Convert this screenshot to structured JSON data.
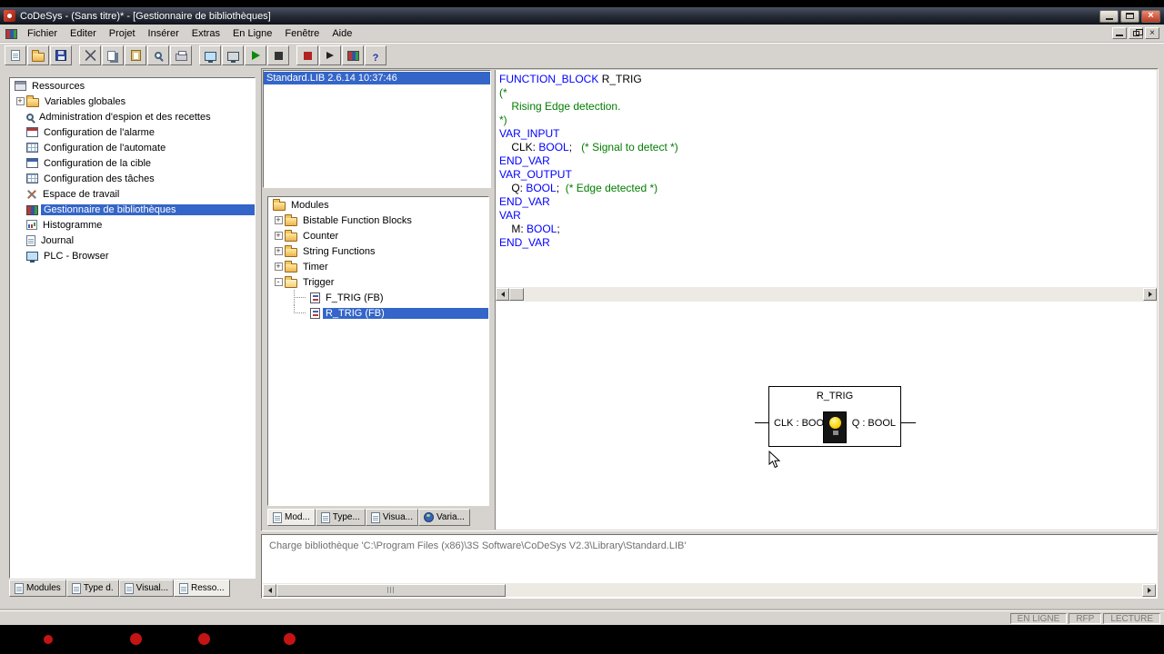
{
  "titlebar": {
    "title": "CoDeSys - (Sans titre)* - [Gestionnaire de bibliothèques]"
  },
  "menubar": {
    "items": [
      "Fichier",
      "Editer",
      "Projet",
      "Insérer",
      "Extras",
      "En Ligne",
      "Fenêtre",
      "Aide"
    ]
  },
  "toolbar": {
    "groups": [
      [
        "new-file",
        "open-file",
        "save"
      ],
      [
        "cut",
        "copy",
        "paste",
        "find",
        "print"
      ],
      [
        "login",
        "logout",
        "run",
        "stop"
      ],
      [
        "breakpoint",
        "step-over",
        "library-manager",
        "help"
      ]
    ]
  },
  "resources": {
    "root_label": "Ressources",
    "items": [
      {
        "label": "Variables globales",
        "icon": "folder",
        "expander": "+"
      },
      {
        "label": "Administration d'espion et des recettes",
        "icon": "magnifier"
      },
      {
        "label": "Configuration de l'alarme",
        "icon": "alarm-config"
      },
      {
        "label": "Configuration de l'automate",
        "icon": "plc-config"
      },
      {
        "label": "Configuration de la cible",
        "icon": "target-config"
      },
      {
        "label": "Configuration des tâches",
        "icon": "task-config"
      },
      {
        "label": "Espace de travail",
        "icon": "workspace"
      },
      {
        "label": "Gestionnaire de bibliothèques",
        "icon": "library",
        "selected": true
      },
      {
        "label": "Histogramme",
        "icon": "histogram"
      },
      {
        "label": "Journal",
        "icon": "journal"
      },
      {
        "label": "PLC - Browser",
        "icon": "plc-browser"
      }
    ],
    "tabs": [
      {
        "label": "Modules",
        "icon": "page"
      },
      {
        "label": "Type d.",
        "icon": "page"
      },
      {
        "label": "Visual...",
        "icon": "page"
      },
      {
        "label": "Resso...",
        "icon": "page",
        "active": true
      }
    ]
  },
  "library_list": {
    "rows": [
      {
        "label": "Standard.LIB 2.6.14 10:37:46",
        "selected": true
      }
    ]
  },
  "module_tree": {
    "root_label": "Modules",
    "items": [
      {
        "label": "Bistable Function Blocks",
        "icon": "folder",
        "expander": "+",
        "level": 1
      },
      {
        "label": "Counter",
        "icon": "folder",
        "expander": "+",
        "level": 1
      },
      {
        "label": "String Functions",
        "icon": "folder",
        "expander": "+",
        "level": 1
      },
      {
        "label": "Timer",
        "icon": "folder",
        "expander": "+",
        "level": 1
      },
      {
        "label": "Trigger",
        "icon": "folder-open",
        "expander": "-",
        "level": 1
      },
      {
        "label": "F_TRIG (FB)",
        "icon": "pou",
        "level": 2
      },
      {
        "label": "R_TRIG (FB)",
        "icon": "pou",
        "level": 2,
        "selected": true,
        "last": true
      }
    ],
    "tabs": [
      {
        "label": "Mod...",
        "icon": "page",
        "active": true
      },
      {
        "label": "Type...",
        "icon": "page"
      },
      {
        "label": "Visua...",
        "icon": "page"
      },
      {
        "label": "Varia...",
        "icon": "globe"
      }
    ]
  },
  "declaration": {
    "lines": [
      [
        {
          "t": "FUNCTION_BLOCK",
          "c": "kw"
        },
        {
          "t": " R_TRIG",
          "c": "txt"
        }
      ],
      [
        {
          "t": "(*",
          "c": "com"
        }
      ],
      [
        {
          "t": "    Rising Edge detection.",
          "c": "com"
        }
      ],
      [
        {
          "t": "*)",
          "c": "com"
        }
      ],
      [
        {
          "t": "VAR_INPUT",
          "c": "kw"
        }
      ],
      [
        {
          "t": "    CLK: ",
          "c": "txt"
        },
        {
          "t": "BOOL",
          "c": "kw"
        },
        {
          "t": ";   ",
          "c": "txt"
        },
        {
          "t": "(* Signal to detect *)",
          "c": "com"
        }
      ],
      [
        {
          "t": "END_VAR",
          "c": "kw"
        }
      ],
      [
        {
          "t": "VAR_OUTPUT",
          "c": "kw"
        }
      ],
      [
        {
          "t": "    Q: ",
          "c": "txt"
        },
        {
          "t": "BOOL",
          "c": "kw"
        },
        {
          "t": ";  ",
          "c": "txt"
        },
        {
          "t": "(* Edge detected *)",
          "c": "com"
        }
      ],
      [
        {
          "t": "END_VAR",
          "c": "kw"
        }
      ],
      [
        {
          "t": "VAR",
          "c": "kw"
        }
      ],
      [
        {
          "t": "    M: ",
          "c": "txt"
        },
        {
          "t": "BOOL",
          "c": "kw"
        },
        {
          "t": ";",
          "c": "txt"
        }
      ],
      [
        {
          "t": "END_VAR",
          "c": "kw"
        }
      ]
    ]
  },
  "diagram": {
    "block_title": "R_TRIG",
    "input_label": "CLK : BOOL",
    "output_label": "Q : BOOL"
  },
  "message_panel": {
    "text": "Charge bibliothèque 'C:\\Program Files (x86)\\3S Software\\CoDeSys V2.3\\Library\\Standard.LIB'"
  },
  "statusbar": {
    "segments": [
      "EN LIGNE",
      "RFP",
      "LECTURE"
    ]
  },
  "colors": {
    "selection": "#3465c8",
    "keyword": "#0000ff",
    "comment": "#007d00"
  }
}
